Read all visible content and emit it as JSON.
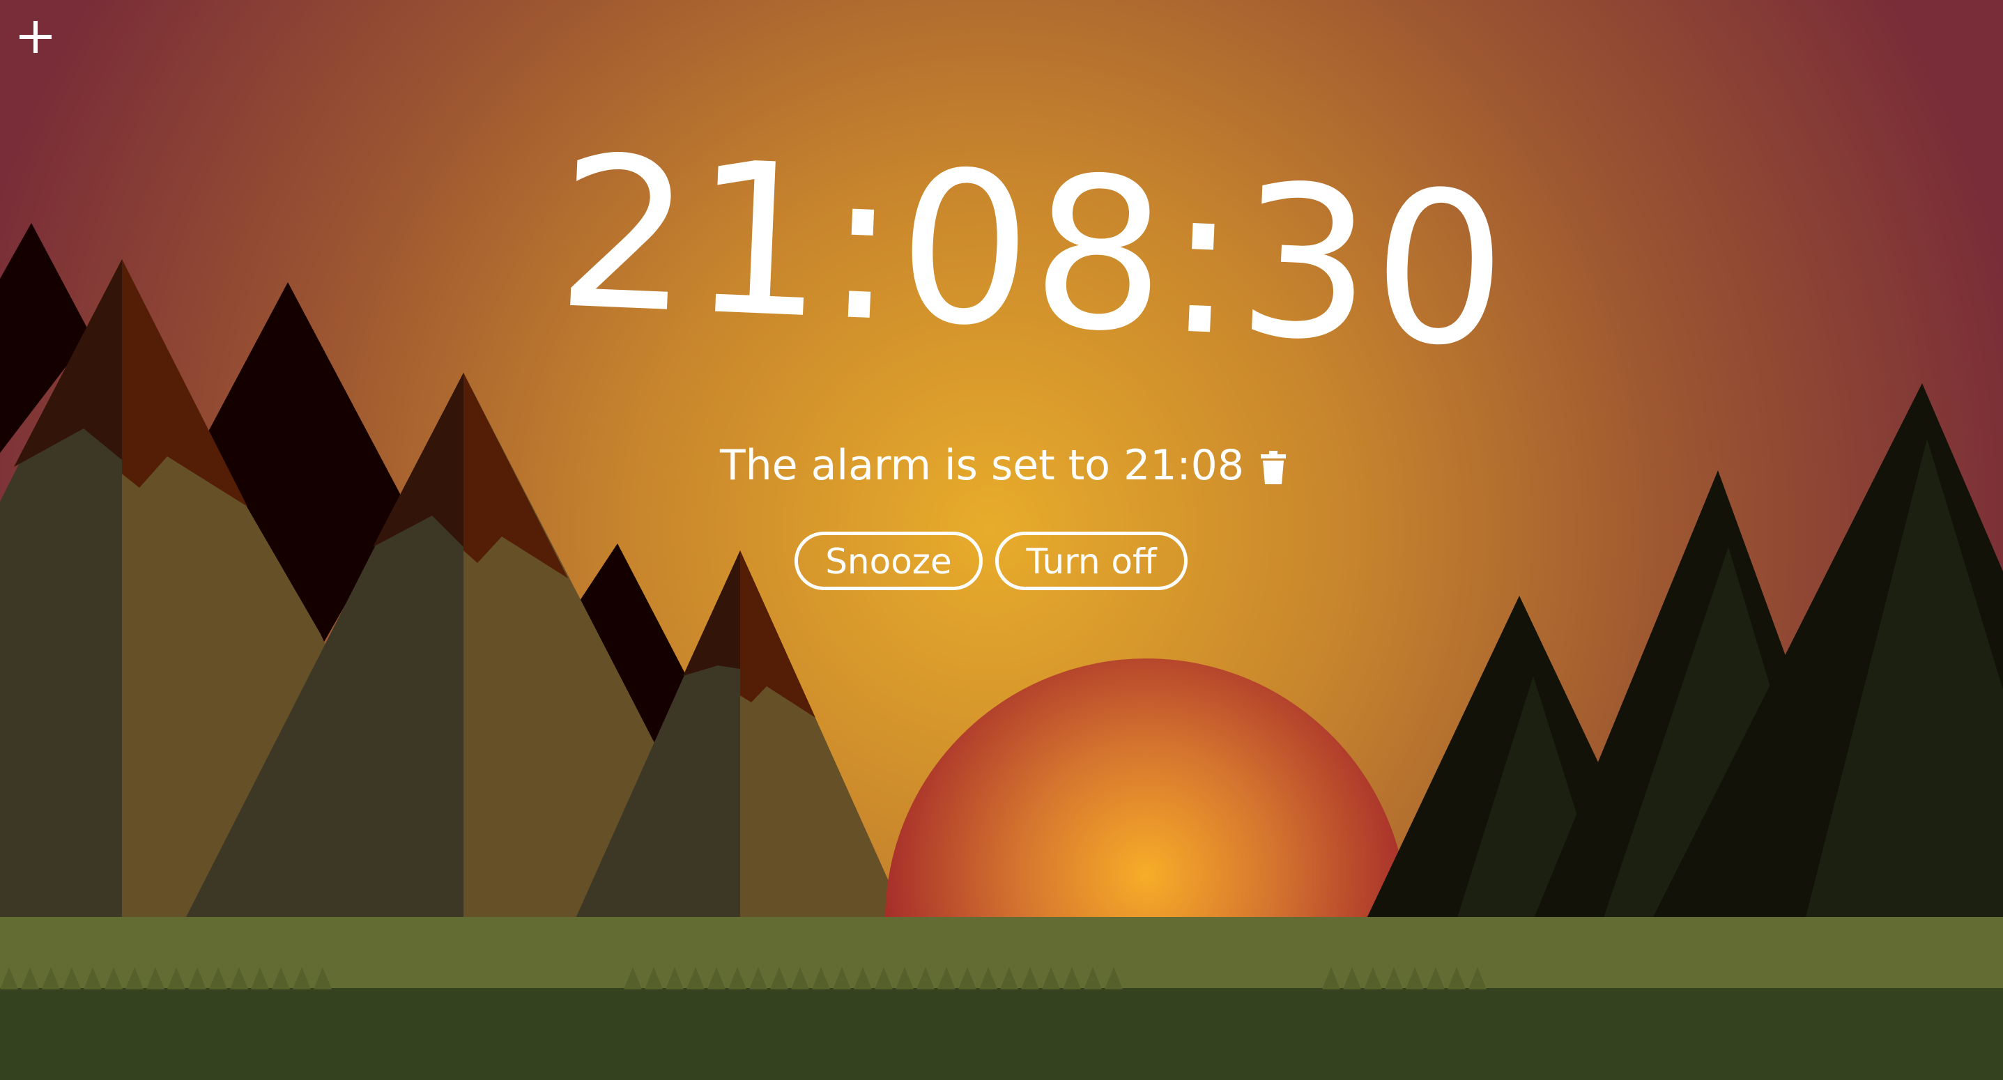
{
  "clock": {
    "time": "21:08:30"
  },
  "alarm": {
    "text": "The alarm is set to 21:08"
  },
  "buttons": {
    "snooze": "Snooze",
    "turn_off": "Turn off"
  },
  "icons": {
    "add": "plus-icon",
    "delete": "trash-icon"
  },
  "colors": {
    "sky_edge": "#782d38",
    "sky_center": "#e6aa2d",
    "sun_outer": "#a02828",
    "sun_inner": "#f5aa28",
    "grass_light": "#626c33",
    "grass_dark": "#34421f",
    "text": "#ffffff"
  }
}
